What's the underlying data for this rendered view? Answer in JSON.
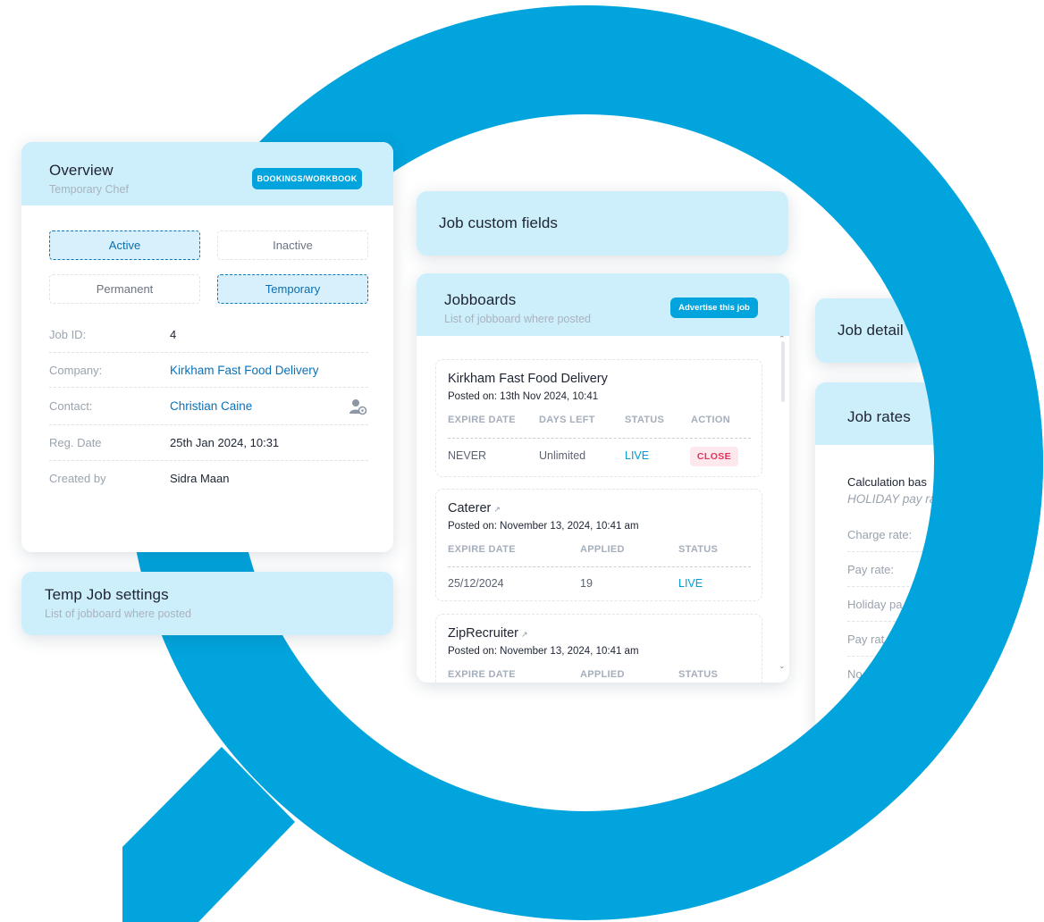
{
  "colors": {
    "brand": "#02A4DD",
    "header_bg": "#CDEEFB",
    "link": "#0A72B8",
    "live": "#039BD6",
    "close": "#E2335B"
  },
  "overview": {
    "title": "Overview",
    "subtitle": "Temporary Chef",
    "button": "BOOKINGS/WORKBOOK",
    "toggles": {
      "active": "Active",
      "inactive": "Inactive",
      "permanent": "Permanent",
      "temporary": "Temporary"
    },
    "rows": [
      {
        "label": "Job ID:",
        "value": "4"
      },
      {
        "label": "Company:",
        "value": "Kirkham Fast Food Delivery"
      },
      {
        "label": "Contact:",
        "value": "Christian Caine"
      },
      {
        "label": "Reg. Date",
        "value": "25th Jan 2024, 10:31"
      },
      {
        "label": "Created by",
        "value": "Sidra Maan"
      }
    ],
    "contact_icon": "user-settings-icon"
  },
  "temp_settings": {
    "title": "Temp Job settings",
    "subtitle": "List of jobboard where posted"
  },
  "custom_fields": {
    "title": "Job custom fields"
  },
  "jobboards": {
    "title": "Jobboards",
    "subtitle": "List of jobboard where posted",
    "button": "Advertise this job",
    "entries": [
      {
        "name": "Kirkham Fast Food Delivery",
        "posted": "Posted on: 13th Nov 2024, 10:41",
        "headers": [
          "EXPIRE DATE",
          "DAYS LEFT",
          "STATUS",
          "ACTION"
        ],
        "values": [
          "NEVER",
          "Unlimited",
          "LIVE",
          "CLOSE"
        ]
      },
      {
        "name": "Caterer",
        "ext_icon": "external-link-icon",
        "posted": "Posted on: November 13, 2024, 10:41 am",
        "headers": [
          "EXPIRE DATE",
          "APPLIED",
          "STATUS"
        ],
        "values": [
          "25/12/2024",
          "19",
          "LIVE"
        ]
      },
      {
        "name": "ZipRecruiter",
        "ext_icon": "external-link-icon",
        "posted": "Posted on: November 13, 2024, 10:41 am",
        "headers": [
          "EXPIRE DATE",
          "APPLIED",
          "STATUS"
        ]
      }
    ]
  },
  "job_details": {
    "title": "Job detail"
  },
  "job_rates": {
    "title": "Job rates",
    "calc_label": "Calculation bas",
    "calc_value": "HOLIDAY pay ra",
    "rows": [
      "Charge rate:",
      "Pay rate:",
      "Holiday pa",
      "Pay rat",
      "No"
    ]
  }
}
